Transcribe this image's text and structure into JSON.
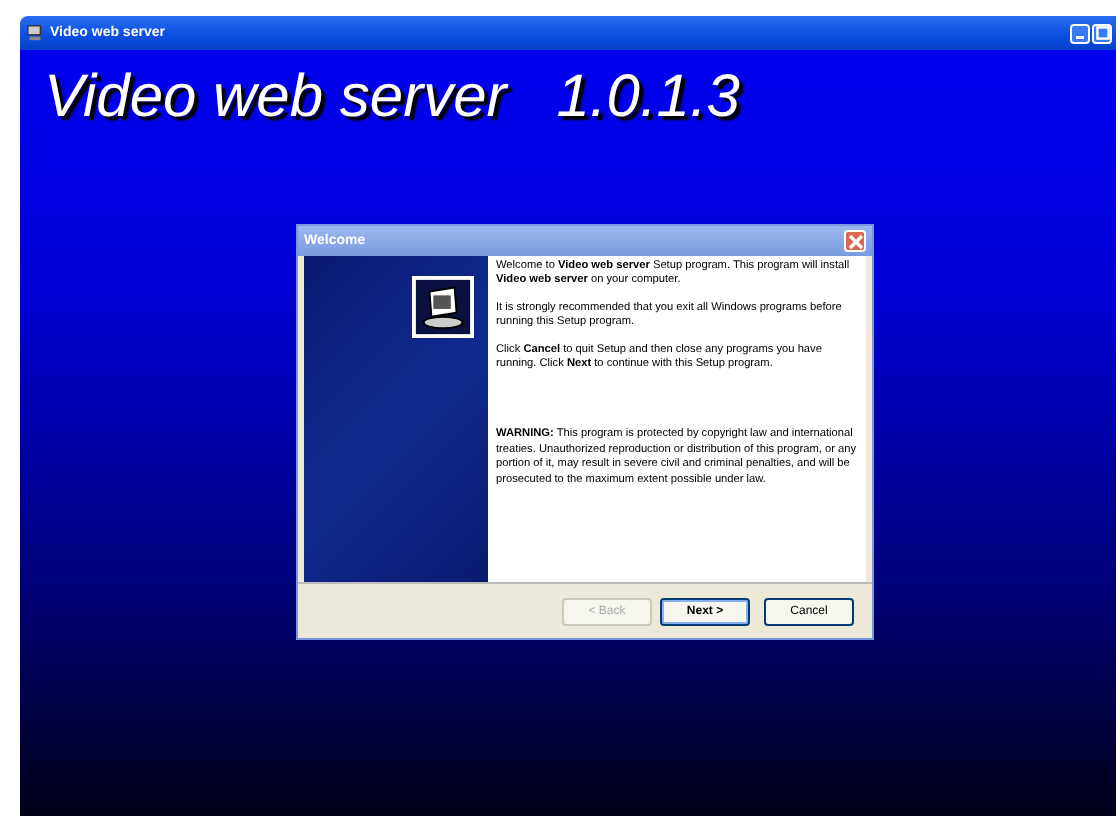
{
  "window": {
    "title": "Video web server"
  },
  "banner": "Video web server   1.0.1.3",
  "dialog": {
    "title": "Welcome",
    "paragraphs": [
      "Welcome to **Video web server** Setup program. This program will install **Video web server** on your computer.",
      "It is strongly recommended that you exit all Windows programs before running this Setup program.",
      "Click **Cancel** to quit Setup and then close any programs you have running. Click **Next** to continue with this Setup program.",
      "**WARNING:** This program is protected by copyright law and international treaties. Unauthorized reproduction or distribution of this program, or any portion of it, may result in severe civil and criminal penalties, and will be prosecuted to the maximum extent possible under law."
    ],
    "buttons": [
      {
        "label": "< Back",
        "disabled": true,
        "default": false
      },
      {
        "label": "Next >",
        "disabled": false,
        "default": true
      },
      {
        "label": "Cancel",
        "disabled": false,
        "default": false
      }
    ]
  }
}
